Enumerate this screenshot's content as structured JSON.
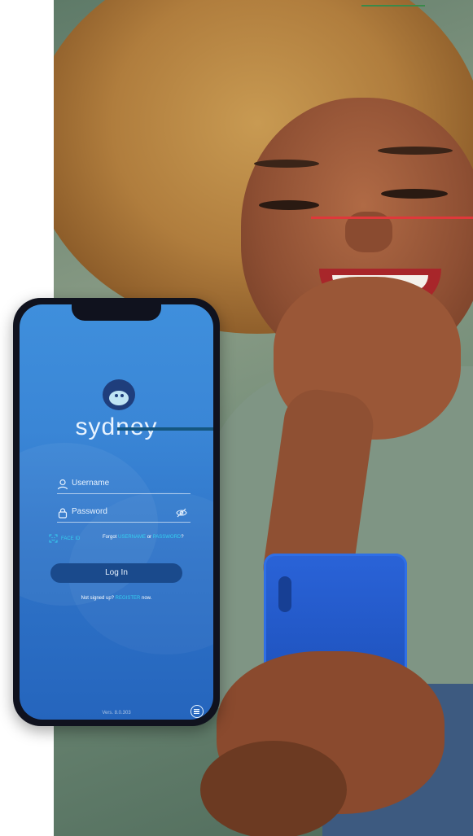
{
  "app": {
    "name": "sydney"
  },
  "login": {
    "username_placeholder": "Username",
    "password_placeholder": "Password",
    "face_id_label": "FACE ID",
    "forgot_prefix": "Forgot ",
    "forgot_username": "USERNAME",
    "forgot_or": " or ",
    "forgot_password": "PASSWORD",
    "forgot_suffix": "?",
    "login_button": "Log In",
    "signup_prefix": "Not signed up? ",
    "signup_register": "REGISTER",
    "signup_suffix": " now.",
    "version": "Vers. 8.0.303"
  },
  "icons": {
    "user": "user-icon",
    "lock": "lock-icon",
    "eye_off": "eye-off-icon",
    "face_id": "face-id-icon",
    "menu": "menu-icon",
    "logo": "seal-logo-icon"
  },
  "colors": {
    "screen_blue": "#3a86d6",
    "button_navy": "#1a4a8c",
    "link_cyan": "#35d0f0"
  }
}
